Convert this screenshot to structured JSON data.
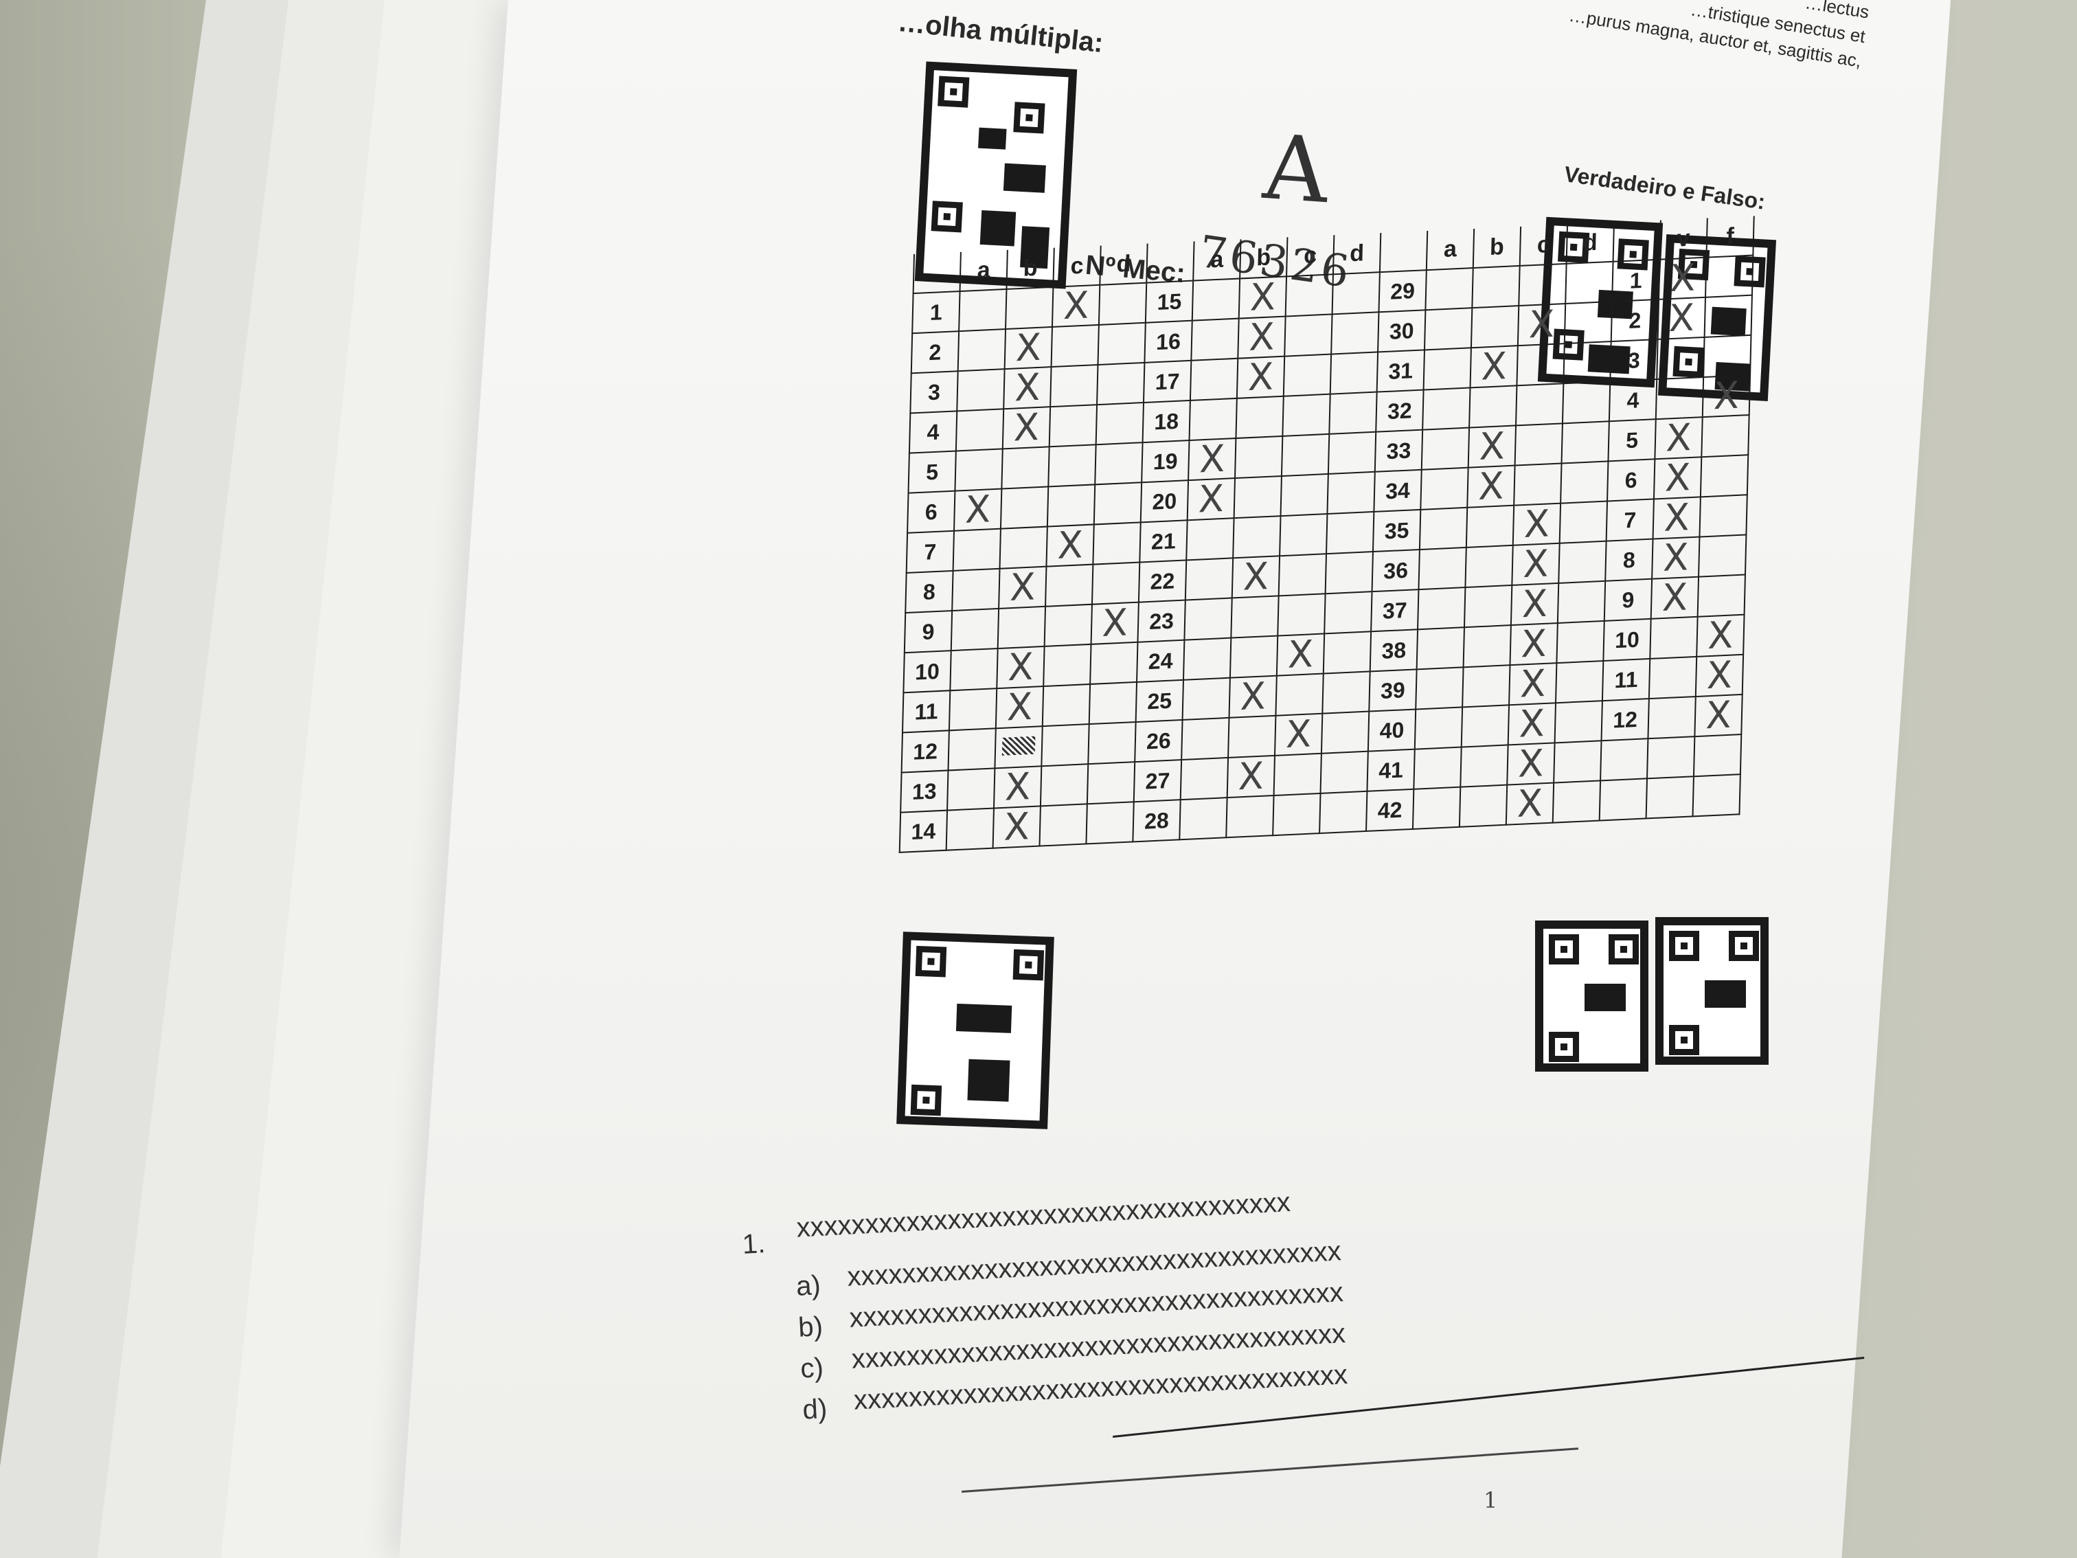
{
  "header": {
    "lorem_line1": "…lectus",
    "lorem_line2": "…tristique senectus et",
    "lorem_line3": "…purus magna, auctor et, sagittis ac,",
    "section_title": "…olha múltipla:",
    "vf_title": "Verdadeiro e Falso:"
  },
  "handwriting": {
    "grade_letter": "A",
    "mec_label": "Nº Mec:",
    "mec_value": "76326"
  },
  "answer_grid": {
    "columns": [
      "a",
      "b",
      "c",
      "d"
    ],
    "vf_columns": [
      "v",
      "f"
    ],
    "rows_block1": [
      "1",
      "2",
      "3",
      "4",
      "5",
      "6",
      "7",
      "8",
      "9",
      "10",
      "11",
      "12",
      "13",
      "14"
    ],
    "rows_block2": [
      "15",
      "16",
      "17",
      "18",
      "19",
      "20",
      "21",
      "22",
      "23",
      "24",
      "25",
      "26",
      "27",
      "28"
    ],
    "rows_block3": [
      "29",
      "30",
      "31",
      "32",
      "33",
      "34",
      "35",
      "36",
      "37",
      "38",
      "39",
      "40",
      "41",
      "42"
    ],
    "rows_vf": [
      "1",
      "2",
      "3",
      "4",
      "5",
      "6",
      "7",
      "8",
      "9",
      "10",
      "11",
      "12"
    ],
    "marks_block1": [
      "c",
      "b",
      "b",
      "b",
      "",
      "a",
      "c",
      "b",
      "d",
      "b",
      "b",
      "b*",
      "b",
      "b"
    ],
    "marks_block2": [
      "b",
      "b",
      "b",
      "",
      "a",
      "a",
      "",
      "b",
      "",
      "c",
      "b",
      "c",
      "b",
      ""
    ],
    "marks_block3": [
      "",
      "c",
      "b",
      "",
      "b",
      "b",
      "c",
      "c",
      "c",
      "c",
      "c",
      "c",
      "c",
      "c"
    ],
    "marks_vf": [
      "v",
      "v",
      "",
      "f",
      "v",
      "v",
      "v",
      "v",
      "v",
      "f",
      "f",
      "f"
    ],
    "mark_symbol": "X"
  },
  "question": {
    "number": "1.",
    "stem": "xxxxxxxxxxxxxxxxxxxxxxxxxxxxxxxxxxxx",
    "options": [
      {
        "letter": "a)",
        "text": "xxxxxxxxxxxxxxxxxxxxxxxxxxxxxxxxxxxx"
      },
      {
        "letter": "b)",
        "text": "xxxxxxxxxxxxxxxxxxxxxxxxxxxxxxxxxxxx"
      },
      {
        "letter": "c)",
        "text": "xxxxxxxxxxxxxxxxxxxxxxxxxxxxxxxxxxxx"
      },
      {
        "letter": "d)",
        "text": "xxxxxxxxxxxxxxxxxxxxxxxxxxxxxxxxxxxx"
      }
    ]
  },
  "footer": {
    "page_number": "1"
  }
}
